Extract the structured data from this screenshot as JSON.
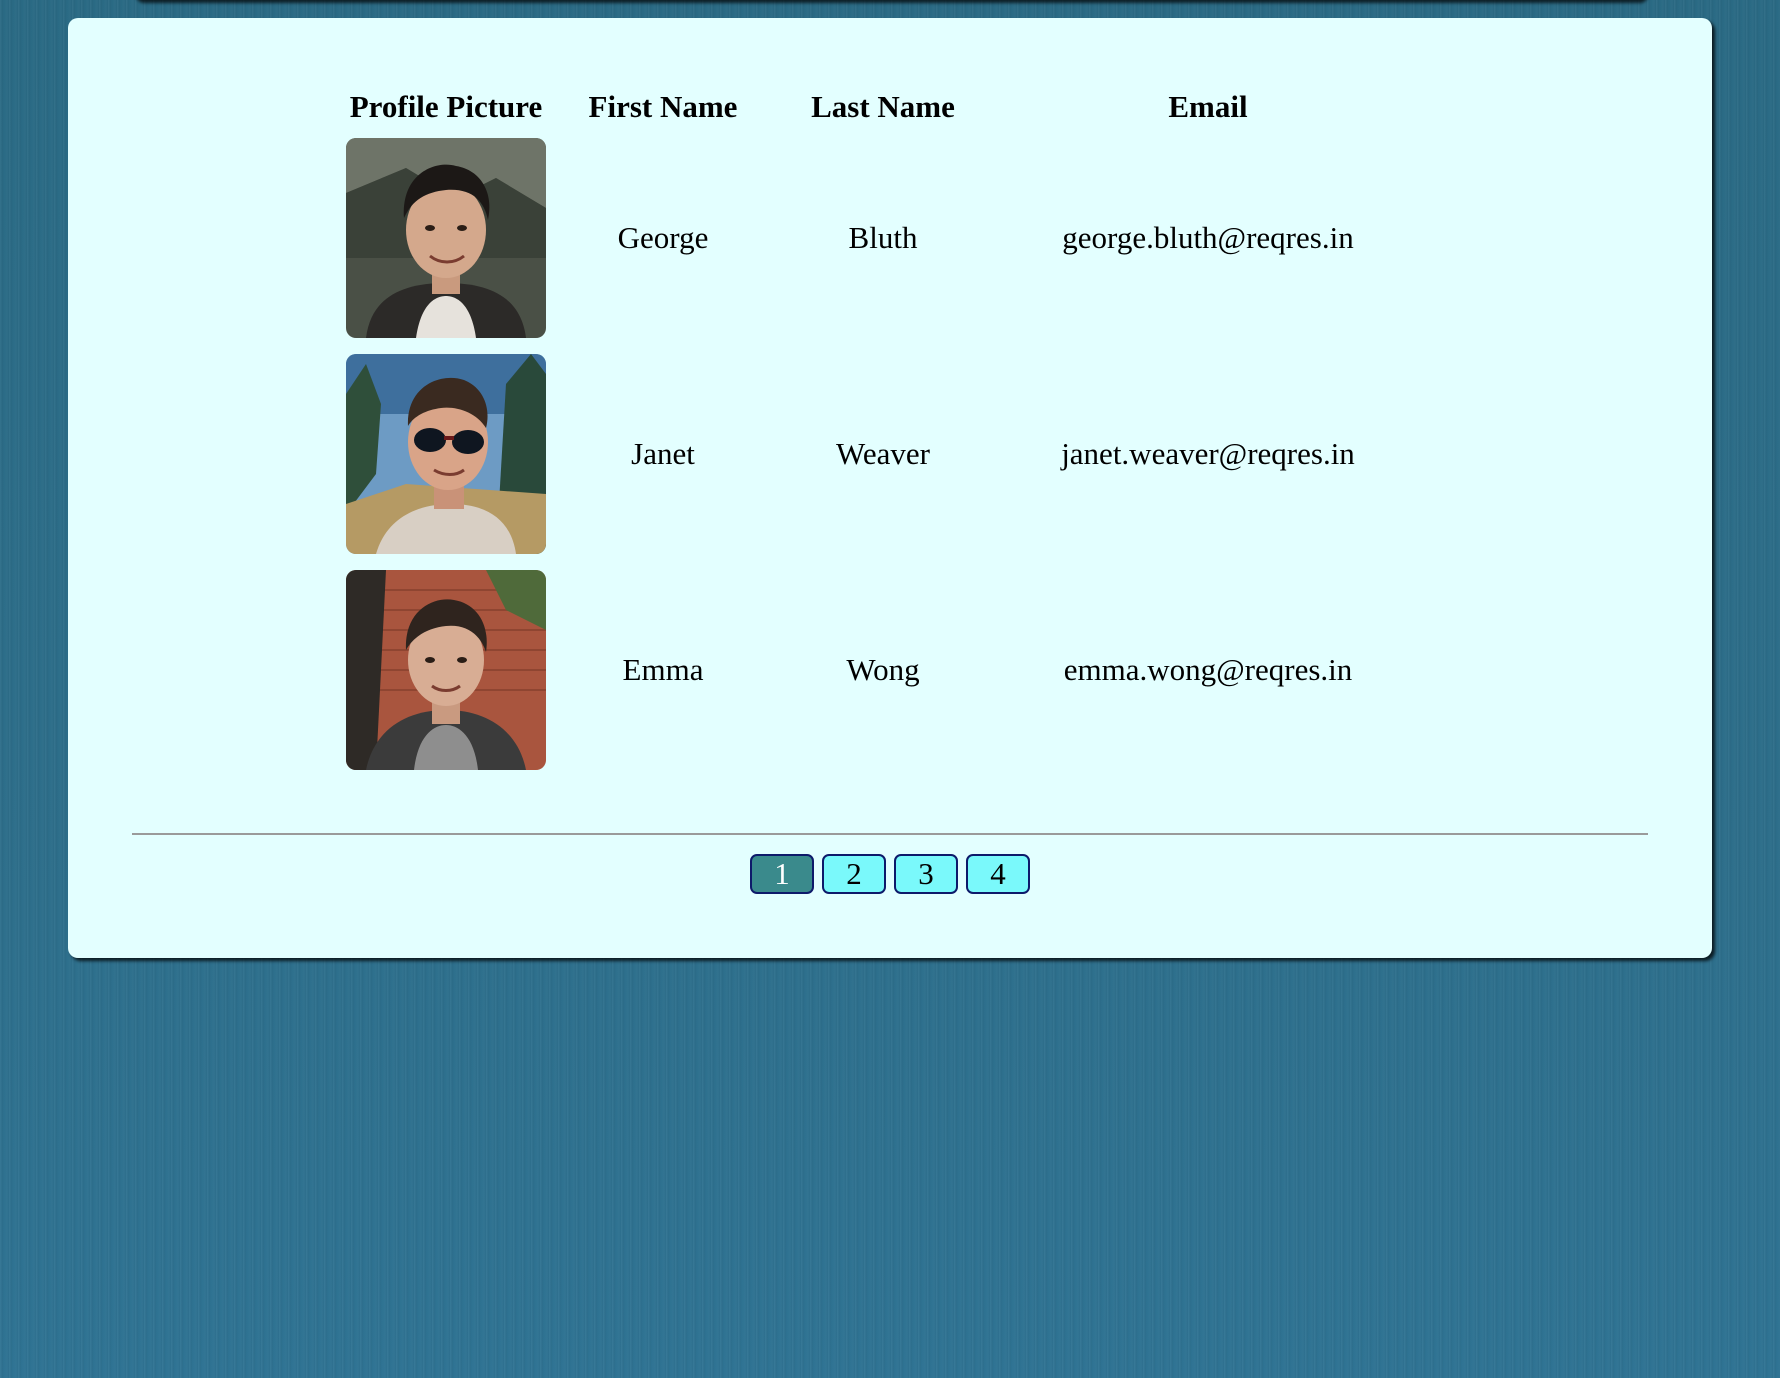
{
  "table": {
    "headers": {
      "picture": "Profile Picture",
      "first_name": "First Name",
      "last_name": "Last Name",
      "email": "Email"
    },
    "rows": [
      {
        "first_name": "George",
        "last_name": "Bluth",
        "email": "george.bluth@reqres.in",
        "avatar": "photo-man-smiling-mountains"
      },
      {
        "first_name": "Janet",
        "last_name": "Weaver",
        "email": "janet.weaver@reqres.in",
        "avatar": "photo-man-sunglasses-trees"
      },
      {
        "first_name": "Emma",
        "last_name": "Wong",
        "email": "emma.wong@reqres.in",
        "avatar": "photo-man-brick-wall"
      }
    ]
  },
  "pagination": {
    "pages": [
      "1",
      "2",
      "3",
      "4"
    ],
    "current": "1"
  },
  "colors": {
    "background": "#2b6c87",
    "card": "#e3ffff",
    "page_button": "#7af9fb",
    "page_button_active": "#3a8a8c",
    "page_button_border": "#0d1a6a"
  }
}
